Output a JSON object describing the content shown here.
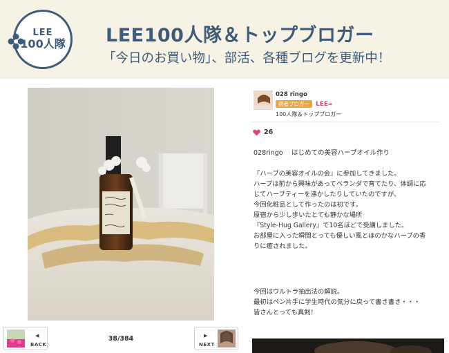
{
  "banner": {
    "logo_top": "LEE",
    "logo_bottom": "100人隊",
    "title": "LEE100人隊＆トップブロガー",
    "subtitle": "「今日のお買い物」、部活、各種ブログを更新中！"
  },
  "navigation": {
    "back_label": "BACK",
    "next_label": "NEXT",
    "counter": "38/384"
  },
  "blogger": {
    "name": "028 ringo",
    "badge": "読者ブロガー",
    "brand_mark": "LEE",
    "group": "100人隊＆トップブロガー"
  },
  "likes": {
    "count": "26"
  },
  "post": {
    "title": "028ringo　 はじめての美容ハーブオイル作り",
    "paragraph1": [
      "『ハーブの美容オイルの会』に参加してきました。",
      "ハーブは前から興味があってベランダで育てたり、体調に応",
      "じてハーブティーを沸かしたりしていたのですが、",
      "今回化粧品として作ったのは初です。",
      "原宿から少し歩いたとても静かな場所",
      "『Style-Hug Gallery』で10名ほどで受講しました。",
      "お部屋に入った瞬間とっても優しい風とほのかなハーブの香",
      "りに癒されました。"
    ],
    "paragraph2": [
      "今回はウルトラ抽出法の解説。",
      "最初はペン片手に学生時代の気分に戻って書き書き・・・",
      "皆さんとっても真剣！"
    ]
  },
  "colors": {
    "banner_bg": "#f7f3e4",
    "brand_navy": "#3e5c7a",
    "badge_orange": "#e9a642",
    "lee_pink": "#e2436d",
    "heart_pink": "#e2436d"
  }
}
